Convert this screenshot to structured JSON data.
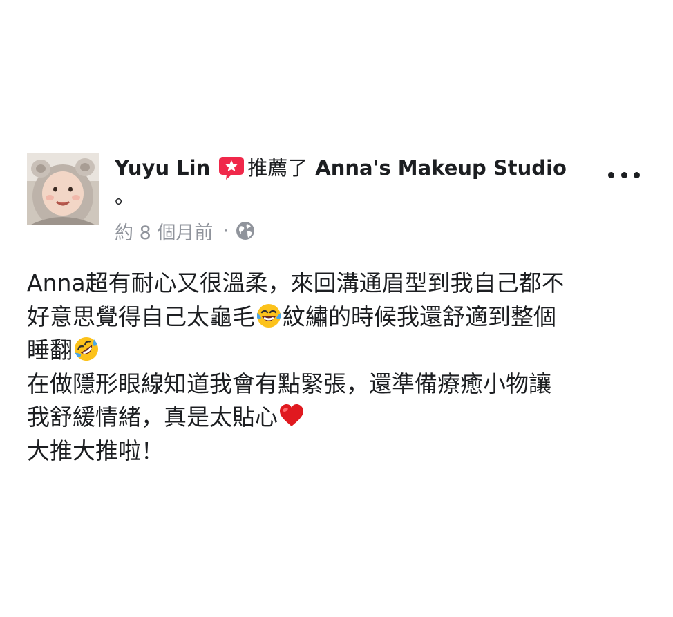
{
  "post": {
    "author_name": "Yuyu Lin",
    "action_verb": "推薦了",
    "page_name": "Anna's Makeup Studio",
    "trailing_period": "。",
    "timestamp": "約 8 個月前",
    "separator": "·",
    "privacy_icon": "globe-icon",
    "recommend_icon": "recommend-star-icon",
    "more_icon": "more-options-icon",
    "body": {
      "line1": "Anna超有耐心又很溫柔，來回溝通眉型到我自己都不",
      "line2_part1": "好意思覺得自己太龜毛",
      "line2_emoji": "face-with-tears-of-joy-emoji",
      "line2_part2": "紋繡的時候我還舒適到整個",
      "line3_part1": "睡翻",
      "line3_emoji": "rolling-on-floor-laughing-emoji",
      "line4": "在做隱形眼線知道我會有點緊張，還準備療癒小物讓",
      "line5_part1": "我舒緩情緒，真是太貼心",
      "line5_emoji": "red-heart-emoji",
      "line6": "大推大推啦！"
    }
  },
  "colors": {
    "text": "#1c1e21",
    "secondary_text": "#90949c",
    "recommend_badge": "#f0284a",
    "background": "#ffffff"
  }
}
